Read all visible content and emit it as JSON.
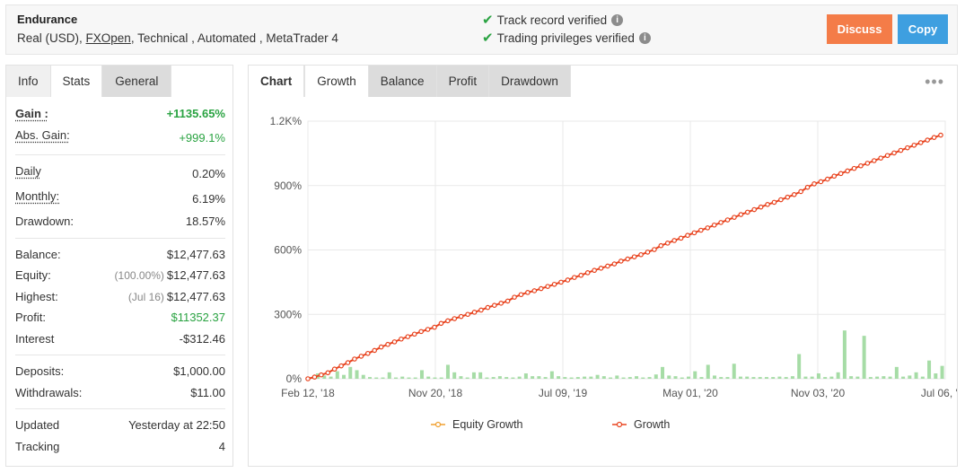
{
  "header": {
    "title": "Endurance",
    "sub_prefix": "Real (USD),",
    "broker_link": "FXOpen",
    "sub_suffix": ", Technical , Automated , MetaTrader 4",
    "verify_track": "Track record verified",
    "verify_trading": "Trading privileges verified",
    "discuss_label": "Discuss",
    "copy_label": "Copy"
  },
  "left_tabs": [
    "Info",
    "Stats",
    "General"
  ],
  "stats": {
    "gain_label": "Gain :",
    "gain_value": "+1135.65%",
    "abs_gain_label": "Abs. Gain:",
    "abs_gain_value": "+999.1%",
    "daily_label": "Daily",
    "daily_value": "0.20%",
    "monthly_label": "Monthly:",
    "monthly_value": "6.19%",
    "drawdown_label": "Drawdown:",
    "drawdown_value": "18.57%",
    "balance_label": "Balance:",
    "balance_value": "$12,477.63",
    "equity_label": "Equity:",
    "equity_pre": "(100.00%)",
    "equity_value": "$12,477.63",
    "highest_label": "Highest:",
    "highest_pre": "(Jul 16)",
    "highest_value": "$12,477.63",
    "profit_label": "Profit:",
    "profit_value": "$11352.37",
    "interest_label": "Interest",
    "interest_value": "-$312.46",
    "deposits_label": "Deposits:",
    "deposits_value": "$1,000.00",
    "withdrawals_label": "Withdrawals:",
    "withdrawals_value": "$11.00",
    "updated_label": "Updated",
    "updated_value": "Yesterday at 22:50",
    "tracking_label": "Tracking",
    "tracking_value": "4"
  },
  "chart_tabs": [
    "Chart",
    "Growth",
    "Balance",
    "Profit",
    "Drawdown"
  ],
  "colors": {
    "growth": "#e8431e",
    "equity": "#f0a030",
    "bars": "#a6dca6",
    "green": "#2aa342"
  },
  "chart_data": {
    "type": "line",
    "x_ticks": [
      "Feb 12, '18",
      "Nov 20, '18",
      "Jul 09, '19",
      "May 01, '20",
      "Nov 03, '20",
      "Jul 06, '21"
    ],
    "y_ticks": [
      "0%",
      "300%",
      "600%",
      "900%",
      "1.2K%"
    ],
    "ylim": [
      0,
      1200
    ],
    "legend": [
      "Equity Growth",
      "Growth"
    ],
    "legend_position": "bottom",
    "grid": true,
    "series": [
      {
        "name": "Growth",
        "values": [
          0,
          8,
          18,
          28,
          45,
          60,
          75,
          92,
          105,
          118,
          132,
          148,
          160,
          172,
          185,
          196,
          208,
          220,
          230,
          240,
          258,
          270,
          280,
          290,
          300,
          310,
          320,
          332,
          342,
          352,
          362,
          380,
          392,
          402,
          410,
          420,
          430,
          440,
          450,
          460,
          472,
          482,
          494,
          505,
          515,
          525,
          535,
          548,
          558,
          568,
          578,
          590,
          602,
          620,
          632,
          644,
          655,
          668,
          680,
          692,
          703,
          716,
          728,
          740,
          752,
          765,
          776,
          788,
          800,
          812,
          822,
          834,
          846,
          858,
          872,
          892,
          908,
          918,
          930,
          944,
          956,
          968,
          980,
          992,
          1004,
          1016,
          1028,
          1040,
          1052,
          1064,
          1076,
          1088,
          1100,
          1112,
          1124,
          1135
        ]
      },
      {
        "name": "Equity Growth",
        "values": [
          0,
          8,
          18,
          28,
          45,
          60,
          75,
          92,
          105,
          118,
          132,
          148,
          160,
          172,
          185,
          196,
          208,
          220,
          230,
          240,
          258,
          270,
          280,
          290,
          300,
          310,
          320,
          332,
          342,
          352,
          362,
          380,
          392,
          402,
          410,
          420,
          430,
          440,
          450,
          460,
          472,
          482,
          494,
          505,
          515,
          525,
          535,
          548,
          558,
          568,
          578,
          590,
          602,
          620,
          632,
          644,
          655,
          668,
          680,
          692,
          703,
          716,
          728,
          740,
          752,
          765,
          776,
          788,
          800,
          812,
          822,
          834,
          846,
          858,
          872,
          892,
          908,
          918,
          930,
          944,
          956,
          968,
          980,
          992,
          1004,
          1016,
          1028,
          1040,
          1052,
          1064,
          1076,
          1088,
          1100,
          1112,
          1124,
          1135
        ]
      }
    ],
    "bars": [
      2,
      25,
      15,
      10,
      35,
      18,
      55,
      40,
      18,
      8,
      6,
      6,
      30,
      6,
      10,
      6,
      6,
      40,
      10,
      6,
      6,
      65,
      30,
      12,
      6,
      30,
      30,
      6,
      8,
      12,
      8,
      6,
      10,
      25,
      12,
      12,
      8,
      35,
      12,
      8,
      6,
      8,
      10,
      10,
      18,
      12,
      6,
      15,
      6,
      8,
      12,
      6,
      8,
      20,
      55,
      15,
      12,
      6,
      10,
      35,
      8,
      65,
      15,
      8,
      8,
      70,
      10,
      10,
      8,
      8,
      8,
      8,
      10,
      8,
      12,
      115,
      10,
      10,
      25,
      8,
      10,
      30,
      225,
      12,
      10,
      200,
      8,
      10,
      12,
      10,
      55,
      10,
      15,
      30,
      10,
      85,
      25,
      60
    ]
  }
}
